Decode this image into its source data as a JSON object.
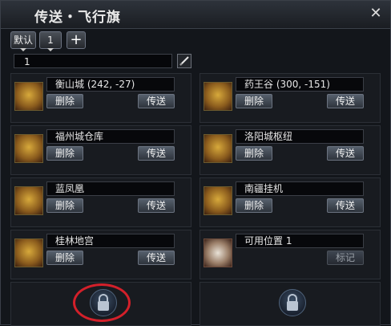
{
  "window": {
    "title": "传送・飞行旗",
    "close_glyph": "✕"
  },
  "tabs": {
    "default_label": "默认",
    "page_label": "1",
    "add_label": "+"
  },
  "set_name": {
    "value": "1"
  },
  "locations": [
    {
      "name": "衡山城 (242, -27)",
      "delete": "删除",
      "teleport": "传送",
      "icon": "golden-bag-icon"
    },
    {
      "name": "药王谷 (300, -151)",
      "delete": "删除",
      "teleport": "传送",
      "icon": "golden-bag-icon"
    },
    {
      "name": "福州城仓库",
      "delete": "删除",
      "teleport": "传送",
      "icon": "golden-bag-icon"
    },
    {
      "name": "洛阳城枢纽",
      "delete": "删除",
      "teleport": "传送",
      "icon": "golden-bag-icon"
    },
    {
      "name": "蓝凤凰",
      "delete": "删除",
      "teleport": "传送",
      "icon": "golden-bag-icon"
    },
    {
      "name": "南疆挂机",
      "delete": "删除",
      "teleport": "传送",
      "icon": "golden-bag-icon"
    },
    {
      "name": "桂林地宫",
      "delete": "删除",
      "teleport": "传送",
      "icon": "golden-bag-icon"
    },
    {
      "name": "可用位置 1",
      "mark": "标记",
      "icon": "scroll-icon"
    }
  ],
  "colors": {
    "highlight_circle": "#d3202a"
  }
}
